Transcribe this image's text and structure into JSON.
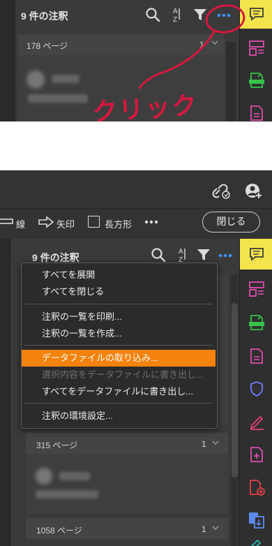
{
  "top_panel": {
    "title": "9 件の注釈",
    "page_label": "178 ページ",
    "page_count": "1",
    "annotation_text": "クリック",
    "annotation_color": "#d6183f"
  },
  "bottom": {
    "toolbar": {
      "line_label": "線",
      "arrow_label": "矢印",
      "rect_label": "長方形",
      "close_label": "閉じる"
    },
    "panel_title": "9 件の注釈",
    "menu_items": [
      "すべてを展開",
      "すべてを閉じる",
      "注釈の一覧を印刷...",
      "注釈の一覧を作成...",
      "データファイルの取り込み...",
      "選択内容をデータファイルに書き出し...",
      "すべてをデータファイルに書き出し...",
      "注釈の環境設定..."
    ],
    "page_groups": [
      {
        "label": "315 ページ",
        "count": "1"
      },
      {
        "label": "1058 ページ",
        "count": "1"
      }
    ],
    "highlight_color": "#f5820b"
  },
  "icons": {
    "rail": [
      "comment-icon",
      "organize-pages-icon",
      "export-pdf-icon",
      "create-pdf-icon",
      "protect-icon",
      "fill-sign-icon",
      "add-file-icon",
      "export-image-icon",
      "combine-files-icon",
      "edit-pdf-icon"
    ]
  }
}
